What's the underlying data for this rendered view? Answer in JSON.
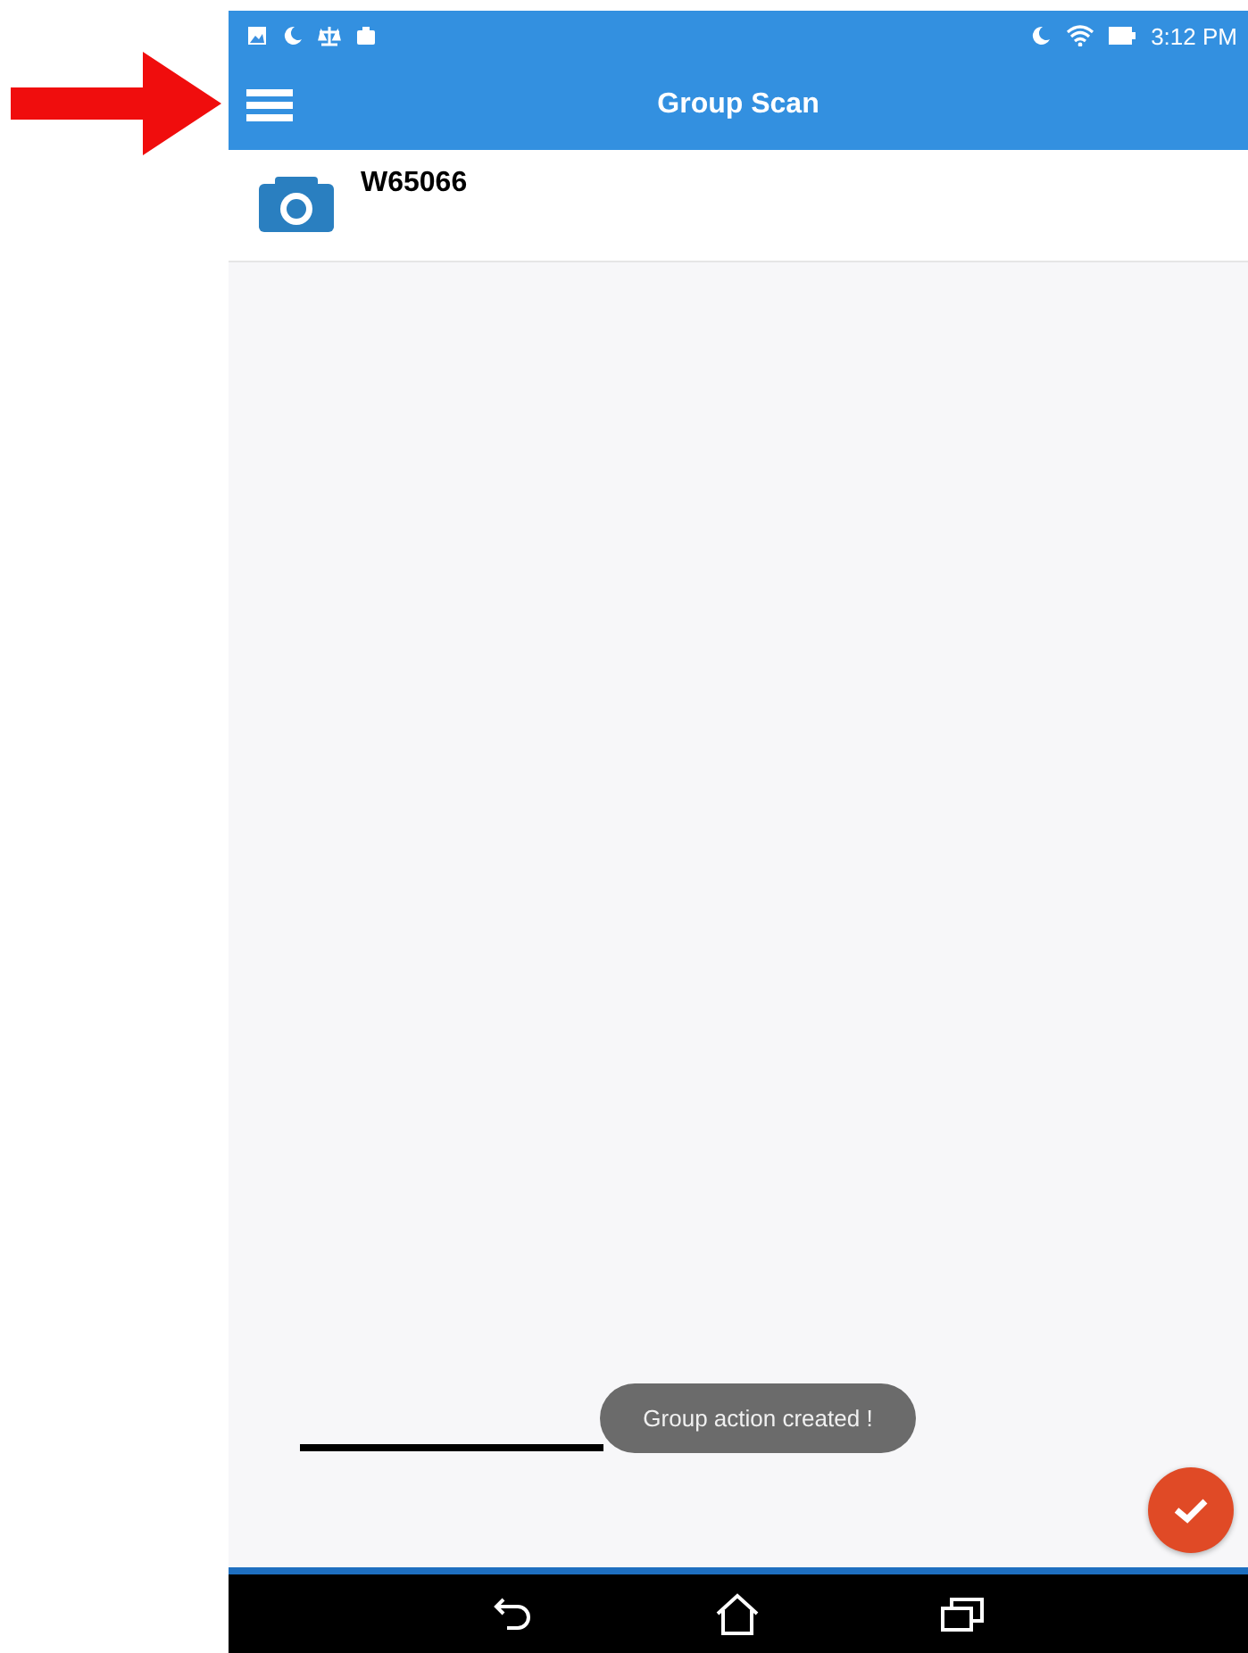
{
  "status_bar": {
    "time": "3:12 PM"
  },
  "app_bar": {
    "title": "Group Scan"
  },
  "items": [
    {
      "label": "W65066"
    }
  ],
  "toast": {
    "text": "Group action created !"
  }
}
